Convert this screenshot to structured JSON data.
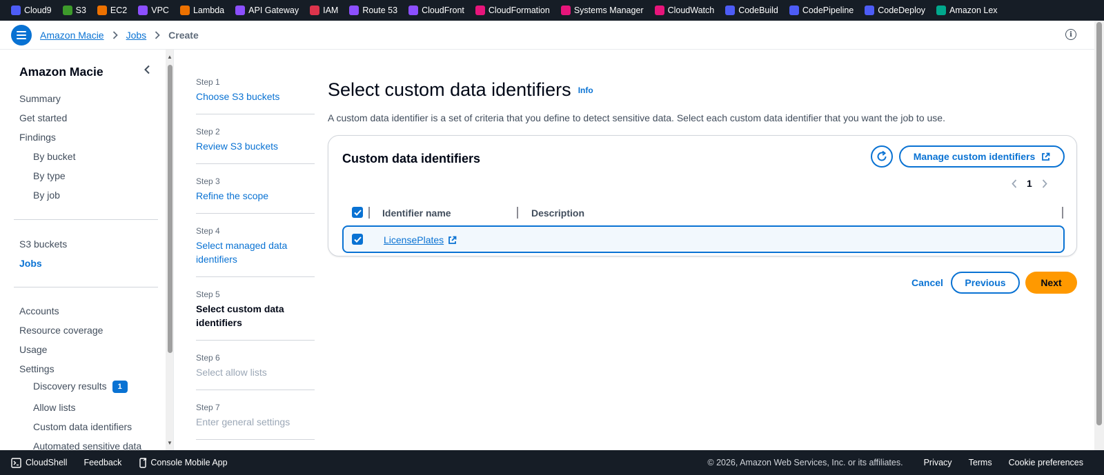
{
  "services": [
    {
      "label": "Cloud9",
      "icon": "cloud9-icon",
      "color": "#4d5cf6"
    },
    {
      "label": "S3",
      "icon": "s3-icon",
      "color": "#3d9a2b"
    },
    {
      "label": "EC2",
      "icon": "ec2-icon",
      "color": "#ed7100"
    },
    {
      "label": "VPC",
      "icon": "vpc-icon",
      "color": "#8c4fff"
    },
    {
      "label": "Lambda",
      "icon": "lambda-icon",
      "color": "#ed7100"
    },
    {
      "label": "API Gateway",
      "icon": "api-gateway-icon",
      "color": "#8c4fff"
    },
    {
      "label": "IAM",
      "icon": "iam-icon",
      "color": "#dd344c"
    },
    {
      "label": "Route 53",
      "icon": "route53-icon",
      "color": "#8c4fff"
    },
    {
      "label": "CloudFront",
      "icon": "cloudfront-icon",
      "color": "#8c4fff"
    },
    {
      "label": "CloudFormation",
      "icon": "cloudformation-icon",
      "color": "#e7157b"
    },
    {
      "label": "Systems Manager",
      "icon": "systems-manager-icon",
      "color": "#e7157b"
    },
    {
      "label": "CloudWatch",
      "icon": "cloudwatch-icon",
      "color": "#e7157b"
    },
    {
      "label": "CodeBuild",
      "icon": "codebuild-icon",
      "color": "#4d5cf6"
    },
    {
      "label": "CodePipeline",
      "icon": "codepipeline-icon",
      "color": "#4d5cf6"
    },
    {
      "label": "CodeDeploy",
      "icon": "codedeploy-icon",
      "color": "#4d5cf6"
    },
    {
      "label": "Amazon Lex",
      "icon": "amazon-lex-icon",
      "color": "#01a88d"
    }
  ],
  "breadcrumb": {
    "items": [
      "Amazon Macie",
      "Jobs"
    ],
    "current": "Create"
  },
  "sidenav": {
    "title": "Amazon Macie",
    "group1": [
      "Summary",
      "Get started",
      "Findings"
    ],
    "findings_sub": [
      "By bucket",
      "By type",
      "By job"
    ],
    "group2": [
      "S3 buckets",
      "Jobs"
    ],
    "active": "Jobs",
    "group3": [
      "Accounts",
      "Resource coverage",
      "Usage",
      "Settings"
    ],
    "settings_sub": [
      "Discovery results",
      "Allow lists",
      "Custom data identifiers",
      "Automated sensitive data"
    ],
    "discovery_badge": "1"
  },
  "steps": [
    {
      "num": "Step 1",
      "label": "Choose S3 buckets",
      "state": "link"
    },
    {
      "num": "Step 2",
      "label": "Review S3 buckets",
      "state": "link"
    },
    {
      "num": "Step 3",
      "label": "Refine the scope",
      "state": "link"
    },
    {
      "num": "Step 4",
      "label": "Select managed data identifiers",
      "state": "link"
    },
    {
      "num": "Step 5",
      "label": "Select custom data identifiers",
      "state": "current"
    },
    {
      "num": "Step 6",
      "label": "Select allow lists",
      "state": "disabled"
    },
    {
      "num": "Step 7",
      "label": "Enter general settings",
      "state": "disabled"
    }
  ],
  "main": {
    "title": "Select custom data identifiers",
    "info": "Info",
    "description": "A custom data identifier is a set of criteria that you define to detect sensitive data. Select each custom data identifier that you want the job to use.",
    "container_title": "Custom data identifiers",
    "manage_button": "Manage custom identifiers",
    "page": "1",
    "columns": [
      "Identifier name",
      "Description"
    ],
    "rows": [
      {
        "name": "LicensePlates",
        "description": "",
        "selected": true
      }
    ]
  },
  "actions": {
    "cancel": "Cancel",
    "previous": "Previous",
    "next": "Next"
  },
  "footer": {
    "cloudshell": "CloudShell",
    "feedback": "Feedback",
    "mobile_app": "Console Mobile App",
    "copyright": "© 2026, Amazon Web Services, Inc. or its affiliates.",
    "privacy": "Privacy",
    "terms": "Terms",
    "cookies": "Cookie preferences"
  },
  "colors": {
    "accent": "#0972d3",
    "primary_button": "#ff9900",
    "bar_bg": "#161d26"
  }
}
